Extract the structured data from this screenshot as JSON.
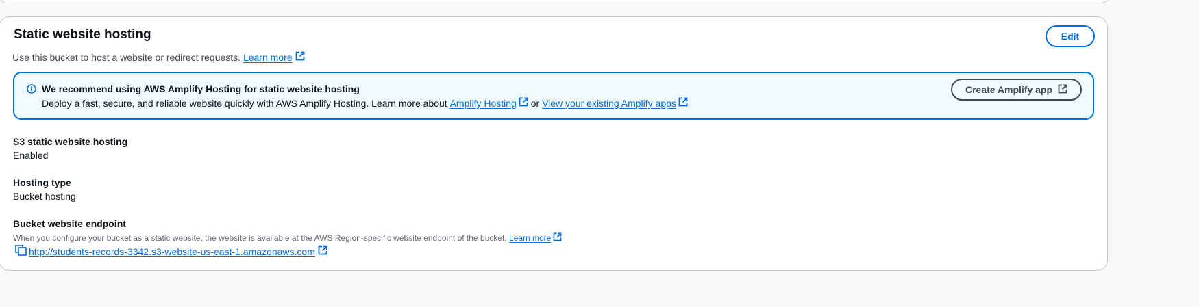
{
  "section": {
    "title": "Static website hosting",
    "edit_label": "Edit",
    "description": "Use this bucket to host a website or redirect requests.",
    "learn_more_label": "Learn more"
  },
  "banner": {
    "title": "We recommend using AWS Amplify Hosting for static website hosting",
    "text_prefix": "Deploy a fast, secure, and reliable website quickly with AWS Amplify Hosting. Learn more about",
    "amplify_hosting_link": "Amplify Hosting",
    "or_text": "or",
    "view_apps_link": "View your existing Amplify apps",
    "create_button_label": "Create Amplify app"
  },
  "fields": {
    "hosting_label": "S3 static website hosting",
    "hosting_value": "Enabled",
    "type_label": "Hosting type",
    "type_value": "Bucket hosting",
    "endpoint_label": "Bucket website endpoint",
    "endpoint_description": "When you configure your bucket as a static website, the website is available at the AWS Region-specific website endpoint of the bucket.",
    "endpoint_learn_more": "Learn more",
    "endpoint_url": "http://students-records-3342.s3-website-us-east-1.amazonaws.com"
  },
  "colors": {
    "link": "#006ce0",
    "banner_background": "#f0fbff",
    "banner_border": "#006ce0",
    "text": "#0f141a"
  },
  "icons": [
    "info-icon",
    "external-link-icon",
    "copy-icon"
  ]
}
